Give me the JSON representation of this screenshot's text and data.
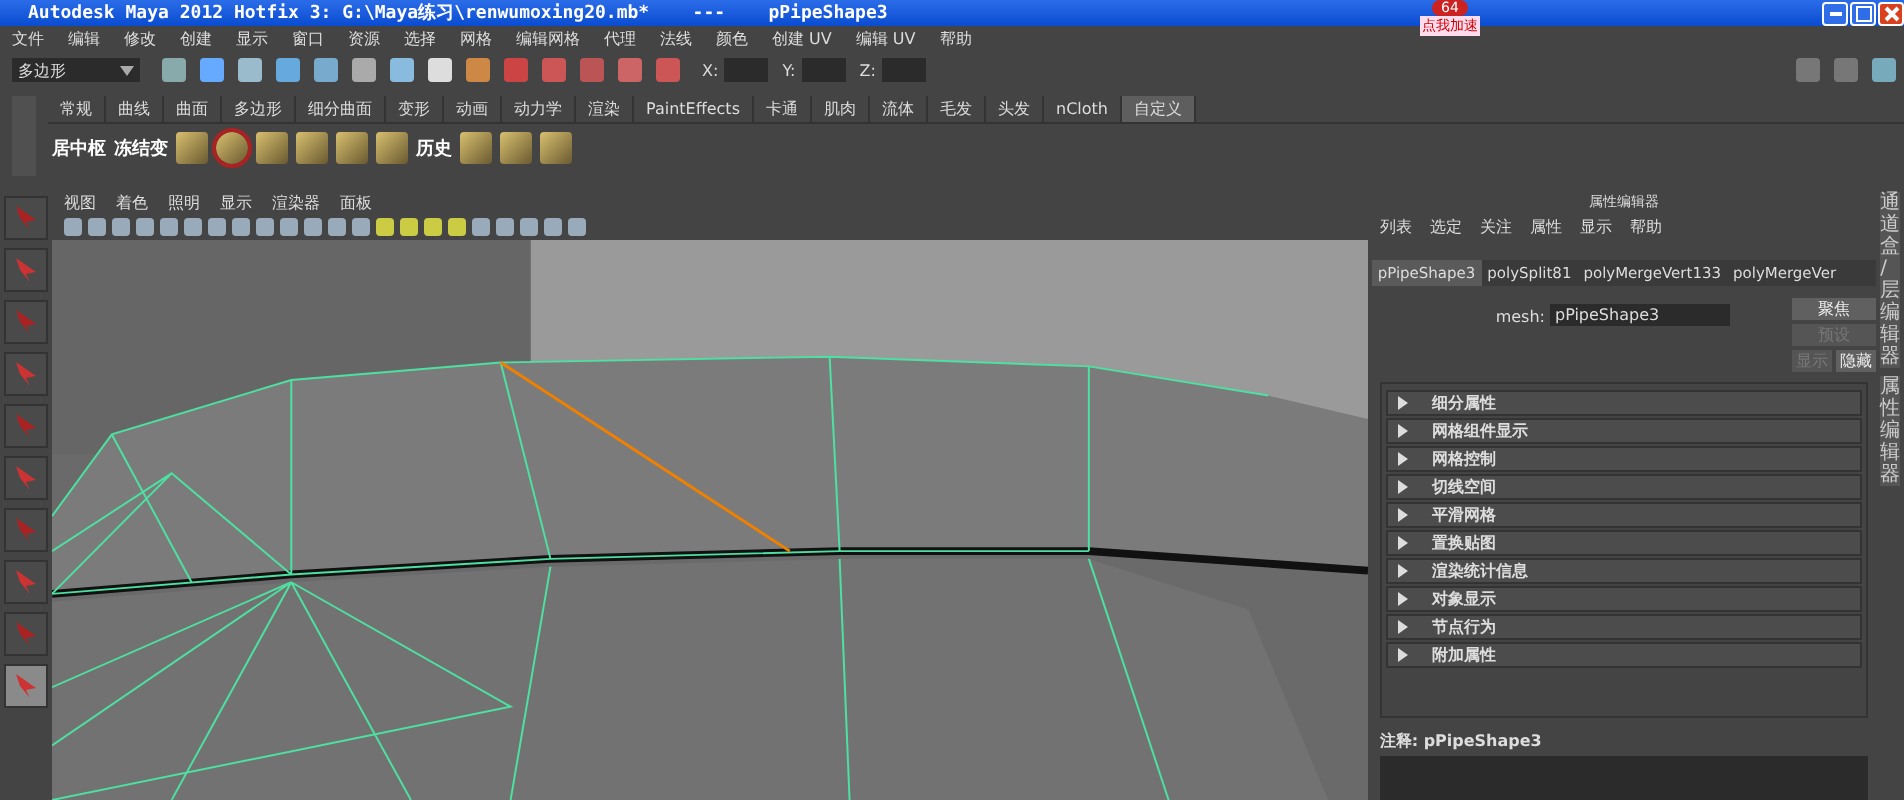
{
  "window": {
    "title": "Autodesk Maya 2012 Hotfix 3: G:\\Maya练习\\renwumoxing20.mb*    ---    pPipeShape3"
  },
  "overlay_badge": {
    "count": "64",
    "label": "点我加速"
  },
  "menu_bar": [
    "文件",
    "编辑",
    "修改",
    "创建",
    "显示",
    "窗口",
    "资源",
    "选择",
    "网格",
    "编辑网格",
    "代理",
    "法线",
    "颜色",
    "创建 UV",
    "编辑 UV",
    "帮助"
  ],
  "status_line": {
    "mode": "多边形",
    "fields": [
      {
        "label": "X:"
      },
      {
        "label": "Y:"
      },
      {
        "label": "Z:"
      }
    ]
  },
  "shelf_tabs": [
    {
      "label": "常规",
      "selected": false
    },
    {
      "label": "曲线",
      "selected": false
    },
    {
      "label": "曲面",
      "selected": false
    },
    {
      "label": "多边形",
      "selected": false
    },
    {
      "label": "细分曲面",
      "selected": false
    },
    {
      "label": "变形",
      "selected": false
    },
    {
      "label": "动画",
      "selected": false
    },
    {
      "label": "动力学",
      "selected": false
    },
    {
      "label": "渲染",
      "selected": false
    },
    {
      "label": "PaintEffects",
      "selected": false
    },
    {
      "label": "卡通",
      "selected": false
    },
    {
      "label": "肌肉",
      "selected": false
    },
    {
      "label": "流体",
      "selected": false
    },
    {
      "label": "毛发",
      "selected": false
    },
    {
      "label": "头发",
      "selected": false
    },
    {
      "label": "nCloth",
      "selected": false
    },
    {
      "label": "自定义",
      "selected": true
    }
  ],
  "shelf_items": [
    {
      "kind": "text",
      "label": "居中枢"
    },
    {
      "kind": "text",
      "label": "冻结变"
    },
    {
      "kind": "icon"
    },
    {
      "kind": "icon",
      "selected": true
    },
    {
      "kind": "icon"
    },
    {
      "kind": "icon"
    },
    {
      "kind": "icon"
    },
    {
      "kind": "icon"
    },
    {
      "kind": "text",
      "label": "历史"
    },
    {
      "kind": "icon"
    },
    {
      "kind": "icon"
    },
    {
      "kind": "icon"
    }
  ],
  "tools": [
    {
      "selected": false
    },
    {
      "selected": false
    },
    {
      "selected": false
    },
    {
      "selected": false
    },
    {
      "selected": false
    },
    {
      "selected": false
    },
    {
      "selected": false
    },
    {
      "selected": false
    },
    {
      "selected": false
    },
    {
      "selected": true
    }
  ],
  "viewport": {
    "menu": [
      "视图",
      "着色",
      "照明",
      "显示",
      "渲染器",
      "面板"
    ]
  },
  "attribute_editor": {
    "title": "属性编辑器",
    "menu": [
      "列表",
      "选定",
      "关注",
      "属性",
      "显示",
      "帮助"
    ],
    "tabs": [
      {
        "label": "pPipeShape3",
        "selected": true
      },
      {
        "label": "polySplit81",
        "selected": false
      },
      {
        "label": "polyMergeVert133",
        "selected": false
      },
      {
        "label": "polyMergeVer",
        "selected": false
      }
    ],
    "mesh_label": "mesh:",
    "mesh_value": "pPipeShape3",
    "buttons": [
      {
        "label": "聚焦",
        "disabled": false
      },
      {
        "label": "预设",
        "disabled": true
      },
      {
        "label": "显示",
        "disabled": true
      },
      {
        "label": "隐藏",
        "disabled": false
      }
    ],
    "sections": [
      "细分属性",
      "网格组件显示",
      "网格控制",
      "切线空间",
      "平滑网格",
      "置换贴图",
      "渲染统计信息",
      "对象显示",
      "节点行为",
      "附加属性"
    ],
    "notes_label": "注释: pPipeShape3"
  },
  "side_tabs": [
    "通道盒/层编辑器",
    "属性编辑器"
  ]
}
